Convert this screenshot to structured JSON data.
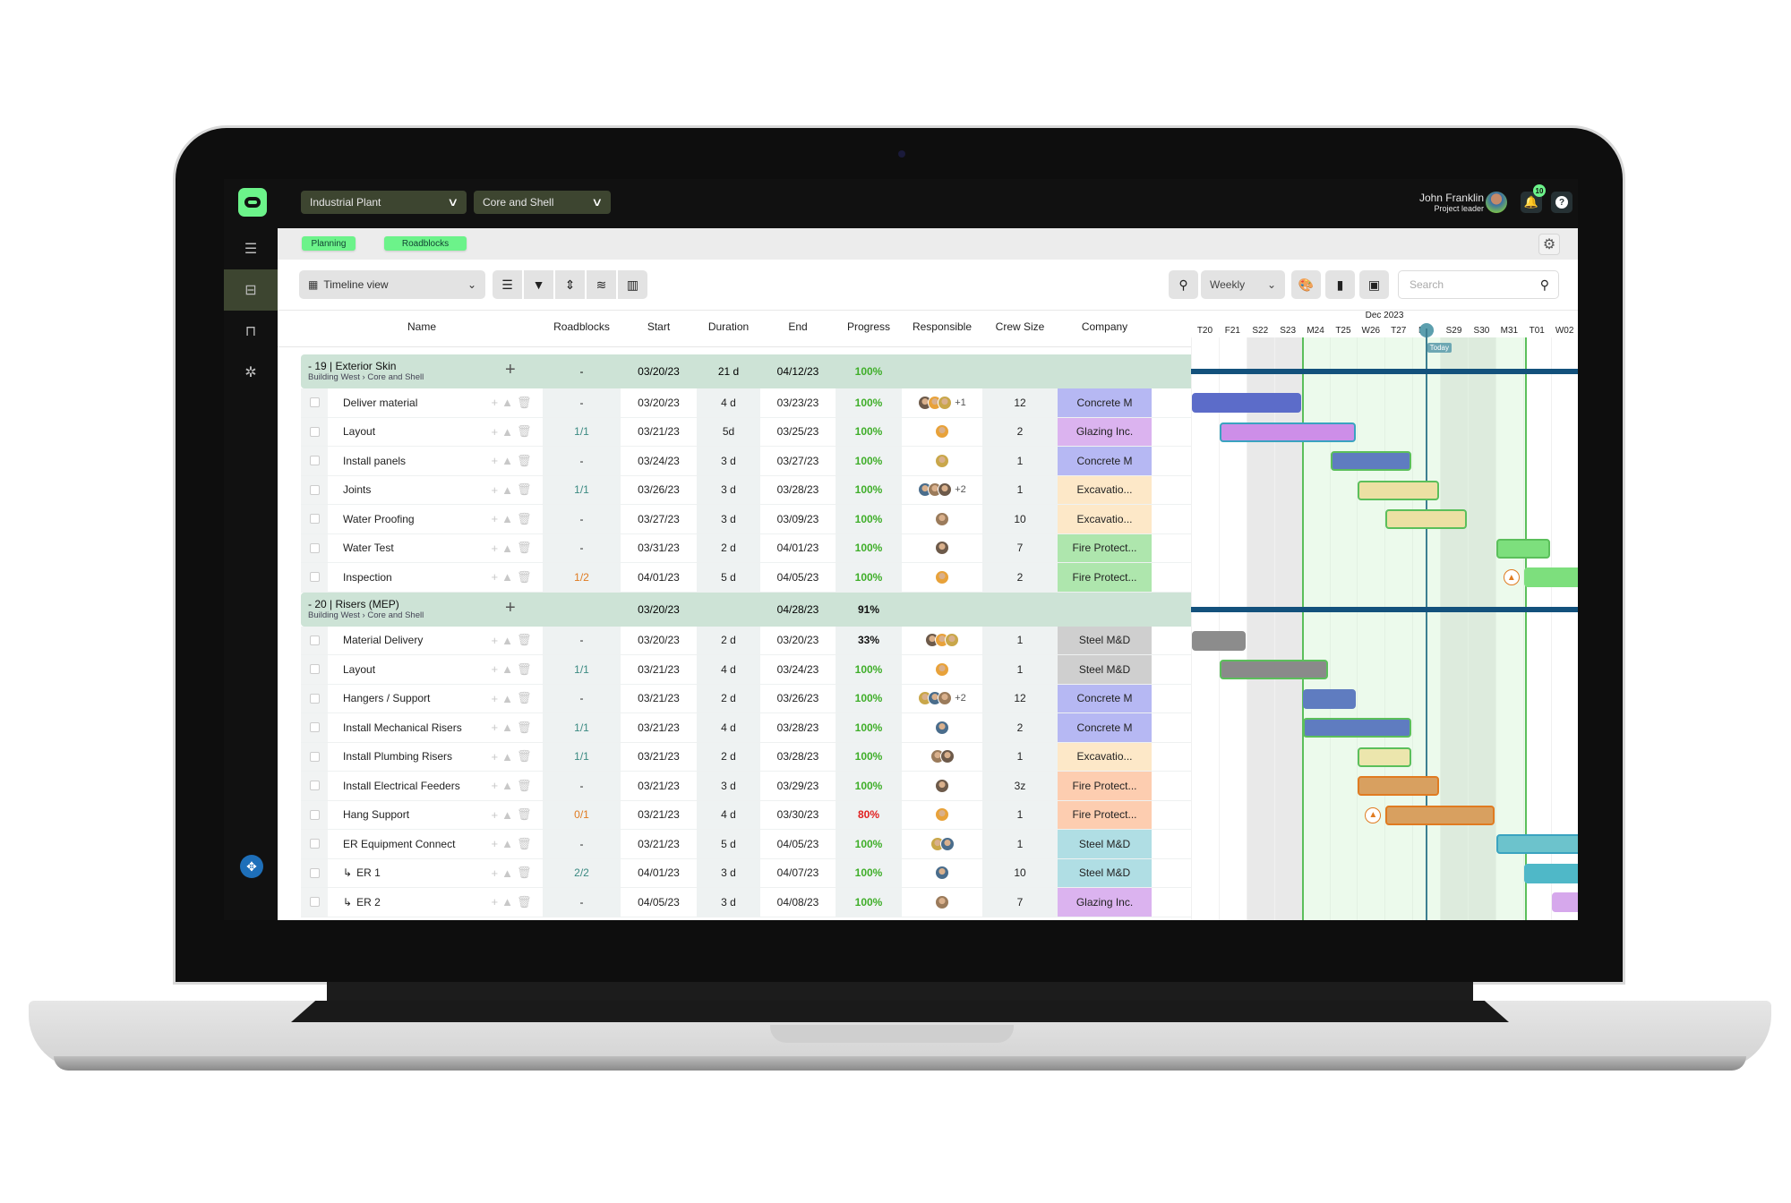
{
  "header": {
    "project_select": "Industrial Plant",
    "phase_select": "Core and Shell",
    "user_name": "John Franklin",
    "user_role": "Project leader",
    "notification_count": "10"
  },
  "tabs": [
    "Planning",
    "Roadblocks"
  ],
  "toolbar": {
    "view_select": "Timeline view",
    "scale_select": "Weekly",
    "search_placeholder": "Search"
  },
  "columns": {
    "name": "Name",
    "roadblocks": "Roadblocks",
    "start": "Start",
    "duration": "Duration",
    "end": "End",
    "progress": "Progress",
    "responsible": "Responsible",
    "crew": "Crew Size",
    "company": "Company"
  },
  "timeline": {
    "month": "Dec 2023",
    "days": [
      "T20",
      "F21",
      "S22",
      "S23",
      "M24",
      "T25",
      "W26",
      "T27",
      "F28",
      "S29",
      "S30",
      "M31",
      "T01",
      "W02"
    ],
    "today_label": "Today",
    "today_index": 8,
    "weekend_indices": [
      2,
      3,
      9,
      10
    ],
    "selected_range": [
      4,
      11
    ]
  },
  "groups": [
    {
      "title": "- 19 | Exterior Skin",
      "path": [
        "Building West",
        "Core and Shell"
      ],
      "roadblocks": "-",
      "start": "03/20/23",
      "duration": "21 d",
      "end": "04/12/23",
      "progress": "100%",
      "progress_color": "green",
      "tasks": [
        {
          "name": "Deliver material",
          "roadblocks": "-",
          "rb_color": "",
          "start": "03/20/23",
          "duration": "4 d",
          "end": "03/23/23",
          "progress": "100%",
          "p_color": "green",
          "avatars": 3,
          "more": "+1",
          "crew": "12",
          "company": "Concrete M",
          "company_color": "#b6b8f3",
          "bar": {
            "start": 0,
            "len": 4,
            "fill": "#5c6cc9",
            "border": "#5c6cc9"
          }
        },
        {
          "name": "Layout",
          "roadblocks": "1/1",
          "rb_color": "teal",
          "start": "03/21/23",
          "duration": "5d",
          "end": "03/25/23",
          "progress": "100%",
          "p_color": "green",
          "avatars": 1,
          "more": "",
          "crew": "2",
          "company": "Glazing Inc.",
          "company_color": "#dbb3ef",
          "bar": {
            "start": 1,
            "len": 5,
            "fill": "#cd8ee8",
            "border": "#3aa3c0"
          }
        },
        {
          "name": "Install panels",
          "roadblocks": "-",
          "rb_color": "",
          "start": "03/24/23",
          "duration": "3 d",
          "end": "03/27/23",
          "progress": "100%",
          "p_color": "green",
          "avatars": 1,
          "more": "",
          "crew": "1",
          "company": "Concrete M",
          "company_color": "#b6b8f3",
          "bar": {
            "start": 5,
            "len": 3,
            "fill": "#5f7cc0",
            "border": "#5bbf5b"
          }
        },
        {
          "name": "Joints",
          "roadblocks": "1/1",
          "rb_color": "teal",
          "start": "03/26/23",
          "duration": "3 d",
          "end": "03/28/23",
          "progress": "100%",
          "p_color": "green",
          "avatars": 3,
          "more": "+2",
          "crew": "1",
          "company": "Excavatio...",
          "company_color": "#fde8c8",
          "bar": {
            "start": 6,
            "len": 3,
            "fill": "#ece0a3",
            "border": "#5bbf5b"
          }
        },
        {
          "name": "Water Proofing",
          "roadblocks": "-",
          "rb_color": "",
          "start": "03/27/23",
          "duration": "3 d",
          "end": "03/09/23",
          "progress": "100%",
          "p_color": "green",
          "avatars": 1,
          "more": "",
          "crew": "10",
          "company": "Excavatio...",
          "company_color": "#fde8c8",
          "bar": {
            "start": 7,
            "len": 3,
            "fill": "#ece0a3",
            "border": "#5bbf5b"
          }
        },
        {
          "name": "Water Test",
          "roadblocks": "-",
          "rb_color": "",
          "start": "03/31/23",
          "duration": "2 d",
          "end": "04/01/23",
          "progress": "100%",
          "p_color": "green",
          "avatars": 1,
          "more": "",
          "crew": "7",
          "company": "Fire Protect...",
          "company_color": "#aee6ad",
          "bar": {
            "start": 11,
            "len": 2,
            "fill": "#7ddf7d",
            "border": "#5bbf5b"
          }
        },
        {
          "name": "Inspection",
          "roadblocks": "1/2",
          "rb_color": "orange",
          "start": "04/01/23",
          "duration": "5 d",
          "end": "04/05/23",
          "progress": "100%",
          "p_color": "green",
          "avatars": 1,
          "more": "",
          "crew": "2",
          "company": "Fire Protect...",
          "company_color": "#aee6ad",
          "bar": {
            "start": 12,
            "len": 5,
            "fill": "#7ddf7d",
            "border": "#7ddf7d",
            "cone": true
          }
        }
      ]
    },
    {
      "title": "- 20 | Risers (MEP)",
      "path": [
        "Building West",
        "Core and Shell"
      ],
      "roadblocks": "",
      "start": "03/20/23",
      "duration": "",
      "end": "04/28/23",
      "progress": "91%",
      "progress_color": "dark",
      "tasks": [
        {
          "name": "Material Delivery",
          "roadblocks": "-",
          "rb_color": "",
          "start": "03/20/23",
          "duration": "2 d",
          "end": "03/20/23",
          "progress": "33%",
          "p_color": "dark",
          "avatars": 3,
          "more": "",
          "crew": "1",
          "company": "Steel M&D",
          "company_color": "#cfcfcf",
          "bar": {
            "start": 0,
            "len": 2,
            "fill": "#8c8c8c",
            "border": "#8c8c8c"
          }
        },
        {
          "name": "Layout",
          "roadblocks": "1/1",
          "rb_color": "teal",
          "start": "03/21/23",
          "duration": "4 d",
          "end": "03/24/23",
          "progress": "100%",
          "p_color": "green",
          "avatars": 1,
          "more": "",
          "crew": "1",
          "company": "Steel M&D",
          "company_color": "#cfcfcf",
          "bar": {
            "start": 1,
            "len": 4,
            "fill": "#8a8a8a",
            "border": "#5bbf5b"
          }
        },
        {
          "name": "Hangers / Support",
          "roadblocks": "-",
          "rb_color": "",
          "start": "03/21/23",
          "duration": "2 d",
          "end": "03/26/23",
          "progress": "100%",
          "p_color": "green",
          "avatars": 3,
          "more": "+2",
          "crew": "12",
          "company": "Concrete M",
          "company_color": "#b6b8f3",
          "bar": {
            "start": 4,
            "len": 2,
            "fill": "#5f7cc0",
            "border": "#5f7cc0"
          }
        },
        {
          "name": "Install Mechanical Risers",
          "roadblocks": "1/1",
          "rb_color": "teal",
          "start": "03/21/23",
          "duration": "4 d",
          "end": "03/28/23",
          "progress": "100%",
          "p_color": "green",
          "avatars": 1,
          "more": "",
          "crew": "2",
          "company": "Concrete M",
          "company_color": "#b6b8f3",
          "bar": {
            "start": 4,
            "len": 4,
            "fill": "#5f7cc0",
            "border": "#5bbf5b"
          }
        },
        {
          "name": "Install Plumbing Risers",
          "roadblocks": "1/1",
          "rb_color": "teal",
          "start": "03/21/23",
          "duration": "2 d",
          "end": "03/28/23",
          "progress": "100%",
          "p_color": "green",
          "avatars": 2,
          "more": "",
          "crew": "1",
          "company": "Excavatio...",
          "company_color": "#fde8c8",
          "bar": {
            "start": 6,
            "len": 2,
            "fill": "#ece6ad",
            "border": "#5bbf5b"
          }
        },
        {
          "name": "Install Electrical Feeders",
          "roadblocks": "-",
          "rb_color": "",
          "start": "03/21/23",
          "duration": "3 d",
          "end": "03/29/23",
          "progress": "100%",
          "p_color": "green",
          "avatars": 1,
          "more": "",
          "crew": "3z",
          "company": "Fire Protect...",
          "company_color": "#fdcdb0",
          "bar": {
            "start": 6,
            "len": 3,
            "fill": "#d8a060",
            "border": "#e07b21"
          }
        },
        {
          "name": "Hang Support",
          "roadblocks": "0/1",
          "rb_color": "orange",
          "start": "03/21/23",
          "duration": "4 d",
          "end": "03/30/23",
          "progress": "80%",
          "p_color": "red",
          "avatars": 1,
          "more": "",
          "crew": "1",
          "company": "Fire Protect...",
          "company_color": "#fdcdb0",
          "bar": {
            "start": 7,
            "len": 4,
            "fill": "#d8a060",
            "border": "#e07b21",
            "cone": true
          }
        },
        {
          "name": "ER Equipment Connect",
          "roadblocks": "-",
          "rb_color": "",
          "start": "03/21/23",
          "duration": "5 d",
          "end": "04/05/23",
          "progress": "100%",
          "p_color": "green",
          "avatars": 2,
          "more": "",
          "crew": "1",
          "company": "Steel M&D",
          "company_color": "#b0dee4",
          "bar": {
            "start": 11,
            "len": 5,
            "fill": "#6cc3cc",
            "border": "#3aa3c0"
          }
        },
        {
          "name": "ER 1",
          "sub": true,
          "roadblocks": "2/2",
          "rb_color": "teal",
          "start": "04/01/23",
          "duration": "3 d",
          "end": "04/07/23",
          "progress": "100%",
          "p_color": "green",
          "avatars": 1,
          "more": "",
          "crew": "10",
          "company": "Steel M&D",
          "company_color": "#b0dee4",
          "bar": {
            "start": 12,
            "len": 3,
            "fill": "#4fb8c8",
            "border": "#4fb8c8"
          }
        },
        {
          "name": "ER 2",
          "sub": true,
          "roadblocks": "-",
          "rb_color": "",
          "start": "04/05/23",
          "duration": "3 d",
          "end": "04/08/23",
          "progress": "100%",
          "p_color": "green",
          "avatars": 1,
          "more": "",
          "crew": "7",
          "company": "Glazing Inc.",
          "company_color": "#dbb3ef",
          "bar": {
            "start": 13,
            "len": 3,
            "fill": "#d6a8ec",
            "border": "#d6a8ec"
          }
        }
      ]
    }
  ],
  "icons": {
    "logo": "app-logo",
    "nav": [
      "timeline-list-icon",
      "gantt-icon",
      "board-icon",
      "analytics-icon"
    ],
    "help": "navigation-help-icon"
  }
}
